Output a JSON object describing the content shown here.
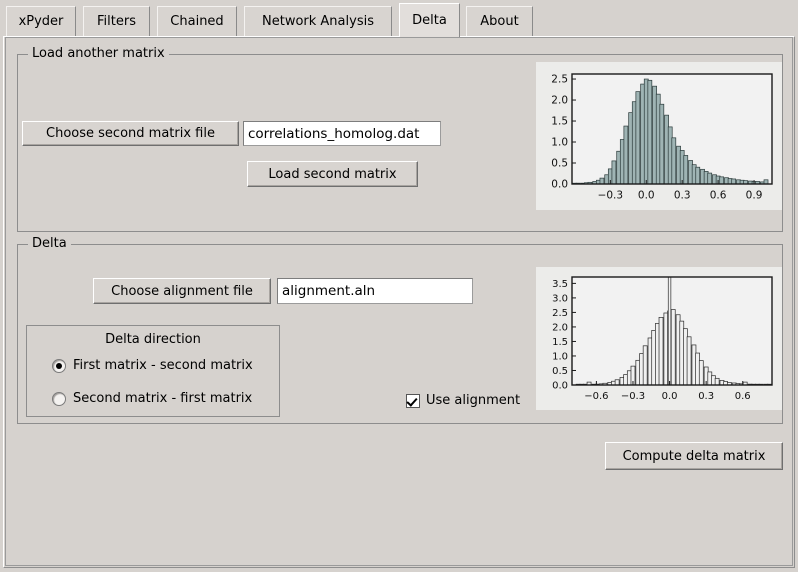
{
  "window": {
    "background": "#d6d2ce"
  },
  "tabs": [
    {
      "label": "xPyder",
      "selected": false
    },
    {
      "label": "Filters",
      "selected": false
    },
    {
      "label": "Chained",
      "selected": false
    },
    {
      "label": "Network Analysis",
      "selected": false
    },
    {
      "label": "Delta",
      "selected": true
    },
    {
      "label": "About",
      "selected": false
    }
  ],
  "load_matrix_group": {
    "legend": "Load another matrix",
    "choose_button": "Choose second matrix file",
    "file_value": "correlations_homolog.dat",
    "load_button": "Load second matrix"
  },
  "delta_group": {
    "legend": "Delta",
    "choose_alignment_button": "Choose alignment file",
    "alignment_value": "alignment.aln",
    "direction_frame": {
      "title": "Delta direction",
      "options": [
        {
          "label": "First matrix - second matrix",
          "selected": true
        },
        {
          "label": "Second matrix - first matrix",
          "selected": false
        }
      ]
    },
    "use_alignment": {
      "label": "Use alignment",
      "checked": true
    }
  },
  "compute_button": "Compute delta matrix",
  "chart_data": [
    {
      "type": "bar",
      "name": "second-matrix-histogram",
      "title": "",
      "xlabel": "",
      "ylabel": "",
      "bar_fill": "#9fb4b4",
      "bar_edge": "#2a3a3a",
      "plot_bg": "#f2f2f2",
      "grid": false,
      "xlim": [
        -0.62,
        1.05
      ],
      "ylim": [
        0.0,
        2.62
      ],
      "xticks": [
        -0.3,
        0.0,
        0.3,
        0.6,
        0.9
      ],
      "xticklabels": [
        "−0.3",
        "0.0",
        "0.3",
        "0.6",
        "0.9"
      ],
      "yticks": [
        0.0,
        0.5,
        1.0,
        1.5,
        2.0,
        2.5
      ],
      "yticklabels": [
        "0.0",
        "0.5",
        "1.0",
        "1.5",
        "2.0",
        "2.5"
      ],
      "bin_width": 0.0334,
      "x": [
        -0.6,
        -0.57,
        -0.53,
        -0.5,
        -0.47,
        -0.43,
        -0.4,
        -0.37,
        -0.33,
        -0.3,
        -0.27,
        -0.23,
        -0.2,
        -0.17,
        -0.13,
        -0.1,
        -0.07,
        -0.03,
        0.0,
        0.03,
        0.07,
        0.1,
        0.13,
        0.17,
        0.2,
        0.23,
        0.27,
        0.3,
        0.33,
        0.37,
        0.4,
        0.43,
        0.47,
        0.5,
        0.53,
        0.57,
        0.6,
        0.63,
        0.67,
        0.7,
        0.73,
        0.77,
        0.8,
        0.83,
        0.87,
        0.9,
        0.93,
        0.97,
        1.0
      ],
      "values": [
        0.01,
        0.02,
        0.02,
        0.03,
        0.04,
        0.06,
        0.09,
        0.14,
        0.22,
        0.36,
        0.55,
        0.78,
        1.06,
        1.38,
        1.7,
        1.96,
        2.2,
        2.38,
        2.5,
        2.47,
        2.33,
        2.14,
        1.9,
        1.64,
        1.36,
        1.1,
        0.9,
        0.8,
        0.68,
        0.56,
        0.46,
        0.4,
        0.35,
        0.3,
        0.26,
        0.22,
        0.19,
        0.17,
        0.15,
        0.13,
        0.12,
        0.1,
        0.09,
        0.08,
        0.07,
        0.06,
        0.06,
        0.05,
        0.1
      ]
    },
    {
      "type": "bar",
      "name": "delta-matrix-histogram",
      "title": "",
      "xlabel": "",
      "ylabel": "",
      "bar_fill": "#f0f0f0",
      "bar_edge": "#2b2b2b",
      "plot_bg": "#f2f2f2",
      "grid": false,
      "xlim": [
        -0.8,
        0.84
      ],
      "ylim": [
        0.0,
        3.72
      ],
      "xticks": [
        -0.6,
        -0.3,
        0.0,
        0.3,
        0.6
      ],
      "xticklabels": [
        "−0.6",
        "−0.3",
        "0.0",
        "0.3",
        "0.6"
      ],
      "yticks": [
        0.0,
        0.5,
        1.0,
        1.5,
        2.0,
        2.5,
        3.0,
        3.5
      ],
      "yticklabels": [
        "0.0",
        "0.5",
        "1.0",
        "1.5",
        "2.0",
        "2.5",
        "3.0",
        "3.5"
      ],
      "bin_width": 0.0328,
      "spike": {
        "x": 0.0,
        "value": 3.72,
        "note": "off-scale spike at zero"
      },
      "x": [
        -0.75,
        -0.72,
        -0.69,
        -0.66,
        -0.62,
        -0.59,
        -0.56,
        -0.53,
        -0.49,
        -0.46,
        -0.43,
        -0.39,
        -0.36,
        -0.33,
        -0.3,
        -0.26,
        -0.23,
        -0.2,
        -0.16,
        -0.13,
        -0.1,
        -0.07,
        -0.03,
        0.0,
        0.03,
        0.07,
        0.1,
        0.13,
        0.16,
        0.2,
        0.23,
        0.26,
        0.3,
        0.33,
        0.36,
        0.39,
        0.43,
        0.46,
        0.49,
        0.53,
        0.56,
        0.59,
        0.62,
        0.66,
        0.69,
        0.72,
        0.75,
        0.79,
        0.82
      ],
      "values": [
        0.01,
        0.01,
        0.02,
        0.1,
        0.02,
        0.03,
        0.04,
        0.06,
        0.09,
        0.13,
        0.18,
        0.26,
        0.36,
        0.49,
        0.65,
        0.85,
        1.08,
        1.35,
        1.62,
        1.88,
        2.12,
        2.33,
        2.48,
        2.55,
        2.6,
        2.42,
        2.2,
        1.94,
        1.66,
        1.38,
        1.1,
        0.84,
        0.62,
        0.45,
        0.32,
        0.23,
        0.16,
        0.12,
        0.09,
        0.07,
        0.05,
        0.04,
        0.1,
        0.03,
        0.02,
        0.02,
        0.01,
        0.01,
        0.01
      ]
    }
  ]
}
